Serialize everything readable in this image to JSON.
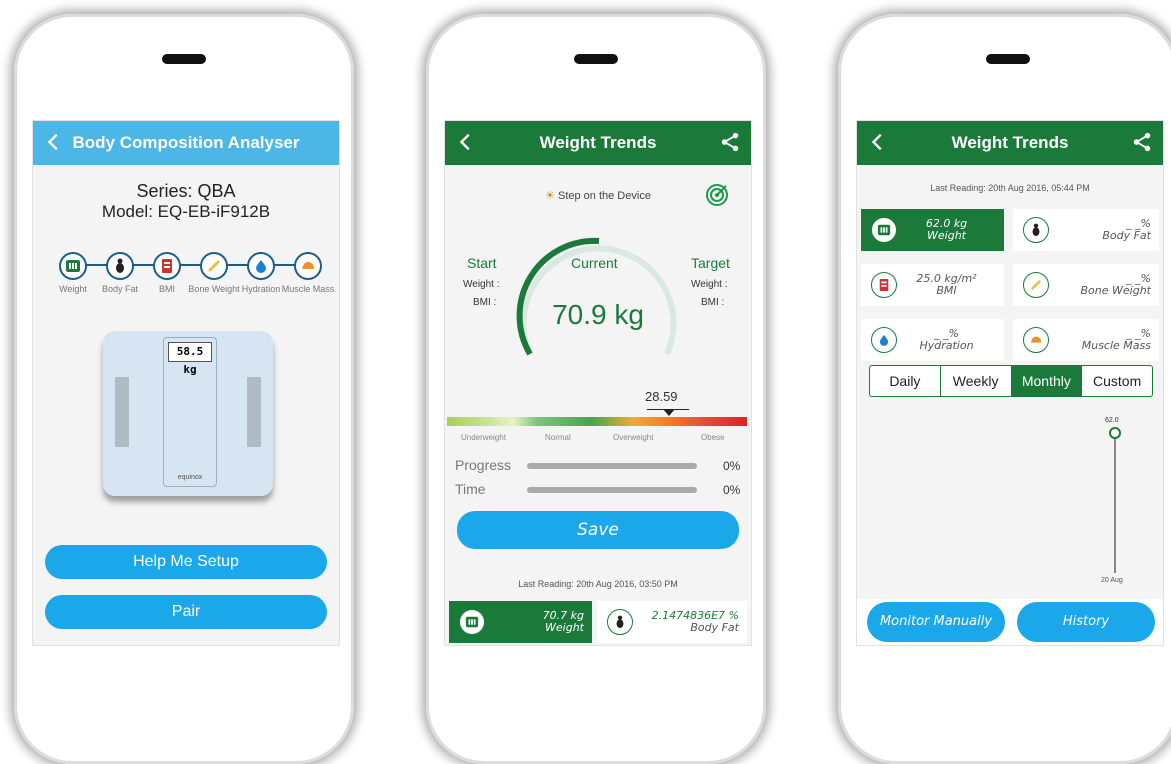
{
  "screen1": {
    "title": "Body Composition Analyser",
    "series": "Series: QBA",
    "model": "Model: EQ-EB-iF912B",
    "metrics": [
      {
        "label": "Weight",
        "icon": "weight-icon"
      },
      {
        "label": "Body Fat",
        "icon": "body-fat-icon"
      },
      {
        "label": "BMI",
        "icon": "bmi-icon"
      },
      {
        "label": "Bone Weight",
        "icon": "bone-icon"
      },
      {
        "label": "Hydration",
        "icon": "water-drop-icon"
      },
      {
        "label": "Muscle Mass",
        "icon": "muscle-icon"
      }
    ],
    "scale_display": "58.5 kg",
    "scale_brand": "equinox",
    "help_button": "Help Me Setup",
    "pair_button": "Pair"
  },
  "screen2": {
    "title": "Weight Trends",
    "step_text": "Step on the Device",
    "start_label": "Start",
    "current_label": "Current",
    "target_label": "Target",
    "weight_label": "Weight :",
    "bmi_label": "BMI :",
    "current_value": "70.9 kg",
    "bmi_value": "28.59",
    "categories": [
      "Underweight",
      "Normal",
      "Overweight",
      "Obese"
    ],
    "progress_label": "Progress",
    "progress_pct": "0%",
    "time_label": "Time",
    "time_pct": "0%",
    "save_button": "Save",
    "last_reading": "Last Reading: 20th Aug 2016, 03:50 PM",
    "tiles": [
      {
        "value": "70.7 kg",
        "name": "Weight"
      },
      {
        "value": "2.1474836E7 %",
        "name": "Body Fat"
      }
    ]
  },
  "screen3": {
    "title": "Weight Trends",
    "last_reading": "Last Reading: 20th Aug 2016, 05:44 PM",
    "tiles": [
      {
        "value": "62.0 kg",
        "name": "Weight"
      },
      {
        "value": "_ _%",
        "name": "Body Fat"
      },
      {
        "value": "25.0 kg/m²",
        "name": "BMI"
      },
      {
        "value": "_ _%",
        "name": "Bone Weight"
      },
      {
        "value": "_ _%",
        "name": "Hydration"
      },
      {
        "value": "_ _%",
        "name": "Muscle Mass"
      }
    ],
    "tabs": [
      "Daily",
      "Weekly",
      "Monthly",
      "Custom"
    ],
    "active_tab": "Monthly",
    "chart_point_label": "62.0",
    "chart_x_label": "20 Aug",
    "monitor_button": "Monitor Manually",
    "history_button": "History"
  },
  "colors": {
    "green": "#1b7a3a",
    "blue": "#1aa8ea",
    "light_blue_bar": "#4cb6e6"
  }
}
